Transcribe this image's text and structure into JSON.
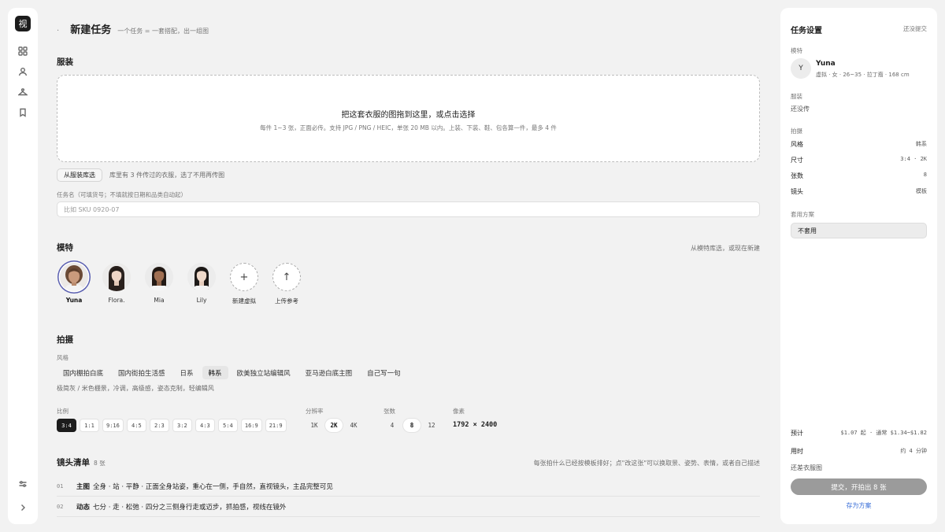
{
  "rail": {
    "logo": "视",
    "icons": [
      "grid-icon",
      "user-icon",
      "hanger-icon",
      "bookmark-icon",
      "sliders-icon",
      "chevron-right-icon"
    ]
  },
  "header": {
    "title": "新建任务",
    "subtitle": "一个任务 = 一套搭配，出一组图"
  },
  "garment": {
    "section_title": "服装",
    "drop_title": "把这套衣服的图拖到这里，或点击选择",
    "drop_hint": "每件 1~3 张，正面必传。支持 JPG / PNG / HEIC，单张 20 MB 以内。上装、下装、鞋、包各算一件，最多 4 件",
    "library_button": "从服装库选",
    "library_note": "库里有 3 件传过的衣服，选了不用再传图",
    "task_name_label": "任务名（可填货号；不填就按日期和品类自动起）",
    "task_name_placeholder": "比如 SKU 0920-07"
  },
  "models": {
    "section_title": "模特",
    "right_link": "从模特库选，或现在新建",
    "items": [
      {
        "name": "Yuna",
        "selected": true
      },
      {
        "name": "Flora.",
        "selected": false
      },
      {
        "name": "Mia",
        "selected": false
      },
      {
        "name": "Lily",
        "selected": false
      }
    ],
    "new_virtual_label": "新建虚拟",
    "new_virtual_glyph": "+",
    "upload_ref_label": "上传参考",
    "upload_ref_glyph": "↑"
  },
  "shoot": {
    "section_title": "拍摄",
    "style_label": "风格",
    "styles": [
      "国内棚拍白底",
      "国内街拍生活感",
      "日系",
      "韩系",
      "欧美独立站编辑风",
      "亚马逊白底主图",
      "自己写一句"
    ],
    "selected_style": "韩系",
    "style_desc": "极简灰 / 米色棚景，冷调，高级感，姿态克制，轻编辑风",
    "ratio_label": "比例",
    "ratios": [
      "3:4",
      "1:1",
      "9:16",
      "4:5",
      "2:3",
      "3:2",
      "4:3",
      "5:4",
      "16:9",
      "21:9"
    ],
    "selected_ratio": "3:4",
    "resolution_label": "分辨率",
    "resolutions": [
      "1K",
      "2K",
      "4K"
    ],
    "selected_resolution": "2K",
    "count_label": "张数",
    "counts": [
      "4",
      "8",
      "12"
    ],
    "selected_count": "8",
    "pixel_label": "像素",
    "pixel_value": "1792 × 2400"
  },
  "shots": {
    "title": "镜头清单",
    "count": "8 张",
    "hint": "每张拍什么已经按模板排好；点\"改这张\"可以换取景、姿势、表情，或者自己描述",
    "rows": [
      {
        "index": "01",
        "keyword": "主图",
        "desc": "全身 · 站 · 平静 · 正面全身站姿，重心在一侧，手自然，直视镜头，主品完整可见"
      },
      {
        "index": "02",
        "keyword": "动态",
        "desc": "七分 · 走 · 松弛 · 四分之三侧身行走或迈步，抓拍感，视线在镜外"
      }
    ]
  },
  "panel": {
    "title": "任务设置",
    "status": "还没提交",
    "model_label": "模特",
    "model_avatar": "Y",
    "model_name": "Yuna",
    "model_desc": "虚拟 · 女 · 26~35 · 拉丁裔 · 168 cm",
    "garment_label": "服装",
    "garment_value": "还没传",
    "shoot_label": "拍摄",
    "shoot_rows": [
      {
        "k": "风格",
        "v": "韩系"
      },
      {
        "k": "尺寸",
        "v": "3:4 · 2K"
      },
      {
        "k": "张数",
        "v": "8"
      },
      {
        "k": "镜头",
        "v": "模板"
      }
    ],
    "plan_label": "套用方案",
    "plan_value": "不套用",
    "estimate_label": "预计",
    "estimate_value": "$1.07 起 · 通常 $1.34~$1.82",
    "time_label": "用时",
    "time_value": "约 4 分钟",
    "missing_note": "还差衣服图",
    "submit_label": "提交，开拍出 8 张",
    "save_plan_label": "存为方案"
  }
}
